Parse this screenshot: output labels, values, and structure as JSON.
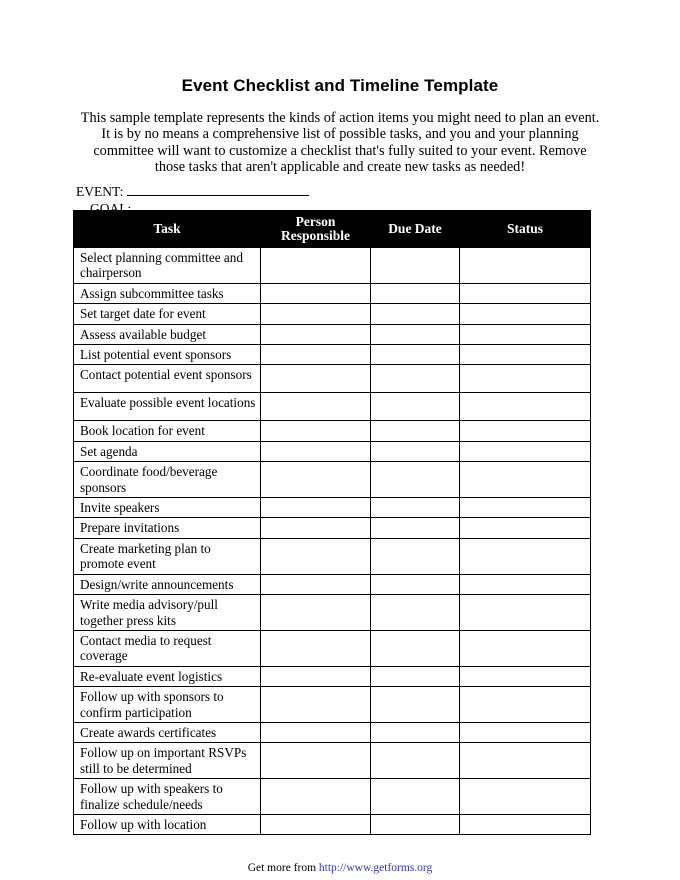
{
  "document": {
    "title": "Event Checklist and Timeline Template",
    "intro": "This sample template represents the kinds of action items you might need to plan an event. It is by no means a comprehensive list of possible tasks, and you and your planning committee will want to customize a checklist that's fully suited to your event. Remove those tasks that aren't applicable and create new tasks as needed!"
  },
  "fields": {
    "event_label": "EVENT:",
    "event_value": "",
    "goal_label": "GOAL:",
    "goal_value": ""
  },
  "table": {
    "headers": {
      "task": "Task",
      "person_responsible": "Person Responsible",
      "person_responsible_line1": "Person",
      "person_responsible_line2": "Responsible",
      "due_date": "Due Date",
      "status": "Status"
    },
    "rows": [
      {
        "task": "Select planning committee and chairperson",
        "person_responsible": "",
        "due_date": "",
        "status": "",
        "lines": 2
      },
      {
        "task": "Assign subcommittee tasks",
        "person_responsible": "",
        "due_date": "",
        "status": "",
        "lines": 1
      },
      {
        "task": "Set target date for event",
        "person_responsible": "",
        "due_date": "",
        "status": "",
        "lines": 1
      },
      {
        "task": "Assess available budget",
        "person_responsible": "",
        "due_date": "",
        "status": "",
        "lines": 1
      },
      {
        "task": "List potential event sponsors",
        "person_responsible": "",
        "due_date": "",
        "status": "",
        "lines": 1
      },
      {
        "task": "Contact potential event sponsors",
        "person_responsible": "",
        "due_date": "",
        "status": "",
        "lines": 2
      },
      {
        "task": "Evaluate possible event locations",
        "person_responsible": "",
        "due_date": "",
        "status": "",
        "lines": 2
      },
      {
        "task": "Book location for event",
        "person_responsible": "",
        "due_date": "",
        "status": "",
        "lines": 1
      },
      {
        "task": "Set agenda",
        "person_responsible": "",
        "due_date": "",
        "status": "",
        "lines": 1
      },
      {
        "task": "Coordinate food/beverage sponsors",
        "person_responsible": "",
        "due_date": "",
        "status": "",
        "lines": 2
      },
      {
        "task": "Invite speakers",
        "person_responsible": "",
        "due_date": "",
        "status": "",
        "lines": 1
      },
      {
        "task": "Prepare invitations",
        "person_responsible": "",
        "due_date": "",
        "status": "",
        "lines": 1
      },
      {
        "task": "Create marketing plan to promote event",
        "person_responsible": "",
        "due_date": "",
        "status": "",
        "lines": 2
      },
      {
        "task": "Design/write announcements",
        "person_responsible": "",
        "due_date": "",
        "status": "",
        "lines": 1
      },
      {
        "task": "Write media advisory/pull together press kits",
        "person_responsible": "",
        "due_date": "",
        "status": "",
        "lines": 2
      },
      {
        "task": "Contact media to request coverage",
        "person_responsible": "",
        "due_date": "",
        "status": "",
        "lines": 2
      },
      {
        "task": "Re-evaluate event logistics",
        "person_responsible": "",
        "due_date": "",
        "status": "",
        "lines": 1
      },
      {
        "task": "Follow up with sponsors to confirm participation",
        "person_responsible": "",
        "due_date": "",
        "status": "",
        "lines": 2
      },
      {
        "task": "Create awards certificates",
        "person_responsible": "",
        "due_date": "",
        "status": "",
        "lines": 1
      },
      {
        "task": "Follow up on important RSVPs still to be determined",
        "person_responsible": "",
        "due_date": "",
        "status": "",
        "lines": 2
      },
      {
        "task": "Follow up with speakers to finalize schedule/needs",
        "person_responsible": "",
        "due_date": "",
        "status": "",
        "lines": 2
      },
      {
        "task": "Follow up with location",
        "person_responsible": "",
        "due_date": "",
        "status": "",
        "lines": 1
      }
    ]
  },
  "footer": {
    "prefix": "Get more from ",
    "url": "http://www.getforms.org"
  },
  "colors": {
    "header_background": "#000000",
    "header_text": "#ffffff",
    "body_text": "#000000",
    "link": "#3333cc",
    "page_background": "#ffffff"
  }
}
